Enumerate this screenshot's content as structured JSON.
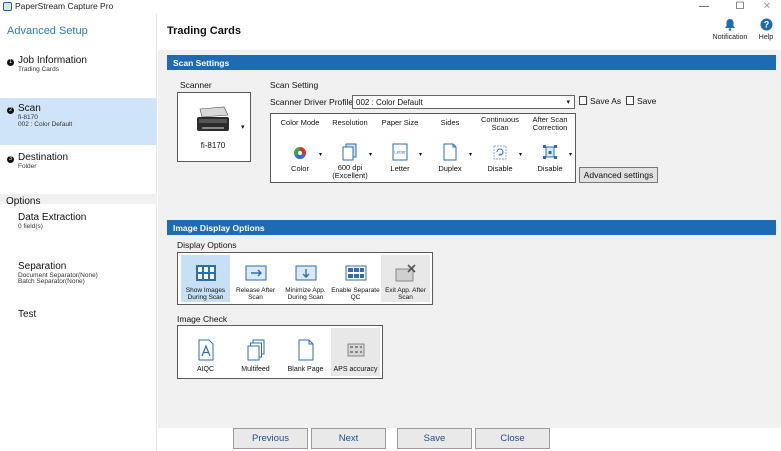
{
  "window": {
    "title": "PaperStream Capture Pro",
    "minimize": "—",
    "maximize": "☐",
    "close": "✕"
  },
  "sidebar": {
    "brand": "Advanced Setup",
    "steps": [
      {
        "num": "1",
        "label": "Job Information",
        "sub": [
          "Trading Cards"
        ]
      },
      {
        "num": "2",
        "label": "Scan",
        "sub": [
          "fi-8170",
          "002 : Color Default"
        ]
      },
      {
        "num": "3",
        "label": "Destination",
        "sub": [
          "Folder"
        ]
      }
    ],
    "options_heading": "Options",
    "options": [
      {
        "label": "Data Extraction",
        "sub": [
          "0 field(s)"
        ]
      },
      {
        "label": "Separation",
        "sub": [
          "Document Separator(None)",
          "Batch Separator(None)"
        ]
      },
      {
        "label": "Test",
        "sub": []
      }
    ]
  },
  "header": {
    "title": "Trading Cards",
    "notification": "Notification",
    "help": "Help"
  },
  "scan_settings": {
    "bar_title": "Scan Settings",
    "scanner_label": "Scanner",
    "scanner_name": "fi-8170",
    "scan_setting_label": "Scan Setting",
    "profile_label": "Scanner Driver Profile",
    "profile_value": "002 : Color Default",
    "save_as": "Save As",
    "save": "Save",
    "columns": [
      {
        "header": "Color Mode",
        "value": "Color",
        "icon": "color-wheel-icon"
      },
      {
        "header": "Resolution",
        "value": "600 dpi\n(Excellent)",
        "icon": "document-icon"
      },
      {
        "header": "Paper Size",
        "value": "Letter",
        "icon": "letter-page-icon",
        "icon_text": "Letter"
      },
      {
        "header": "Sides",
        "value": "Duplex",
        "icon": "duplex-page-icon"
      },
      {
        "header": "Continuous\nScan",
        "value": "Disable",
        "icon": "continuous-scan-icon"
      },
      {
        "header": "After Scan\nCorrection",
        "value": "Disable",
        "icon": "correction-icon"
      }
    ],
    "advanced_button": "Advanced settings"
  },
  "image_display": {
    "bar_title": "Image Display Options",
    "display_options_label": "Display Options",
    "display_options": [
      {
        "label": "Show Images\nDuring Scan",
        "selected": true
      },
      {
        "label": "Release After\nScan",
        "selected": false
      },
      {
        "label": "Minimize App.\nDuring Scan",
        "selected": false
      },
      {
        "label": "Enable Separate\nQC",
        "selected": false
      },
      {
        "label": "Exit App. After\nScan",
        "selected": false
      }
    ],
    "image_check_label": "Image Check",
    "image_checks": [
      {
        "label": "AIQC"
      },
      {
        "label": "Multifeed"
      },
      {
        "label": "Blank Page"
      },
      {
        "label": "APS accuracy"
      }
    ]
  },
  "footer": {
    "previous": "Previous",
    "next": "Next",
    "save": "Save",
    "close": "Close"
  },
  "colors": {
    "accent": "#1f6bb3",
    "brand_text": "#2a7bc5",
    "active_nav": "#cfe4f6",
    "panel_bg": "#f0f0f0"
  }
}
